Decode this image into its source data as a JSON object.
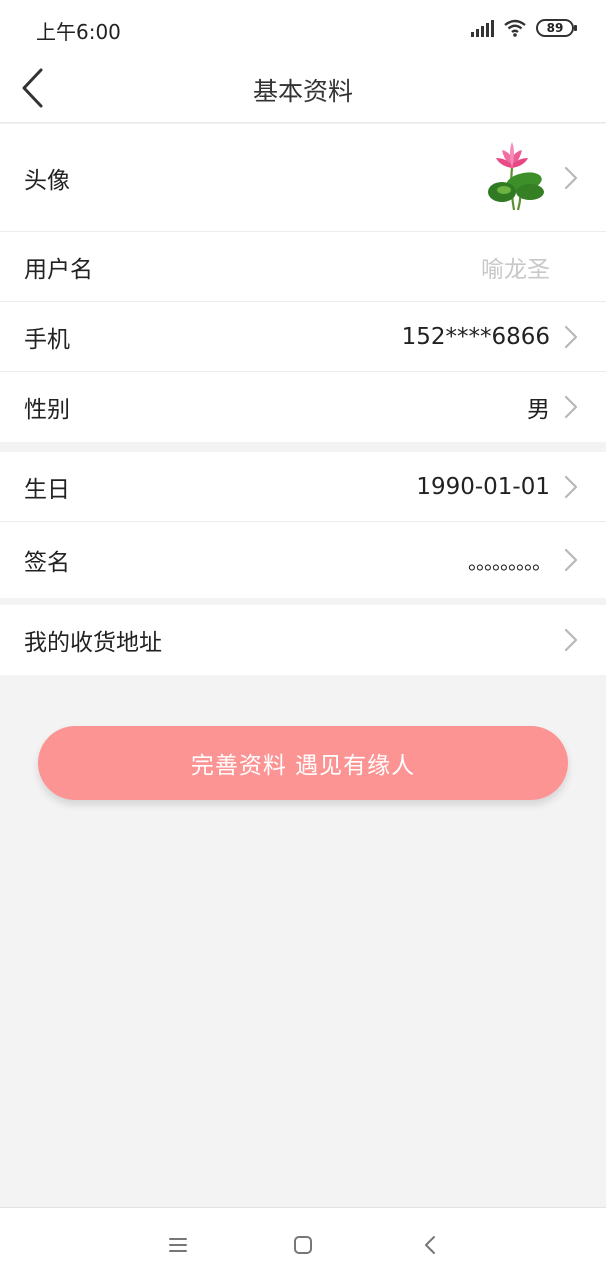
{
  "status_bar": {
    "time": "上午6:00",
    "battery": "89",
    "icons": [
      "signal-icon",
      "wifi-icon",
      "battery-icon"
    ]
  },
  "header": {
    "title": "基本资料",
    "back_icon": "back-chevron-icon"
  },
  "profile": {
    "avatar": {
      "label": "头像",
      "image": "lotus-avatar"
    },
    "username": {
      "label": "用户名",
      "value": "喻龙圣"
    },
    "phone": {
      "label": "手机",
      "value": "152****6866"
    },
    "gender": {
      "label": "性别",
      "value": "男"
    },
    "birthday": {
      "label": "生日",
      "value": "1990-01-01"
    },
    "signature": {
      "label": "签名",
      "value": "。。。。。。。。。"
    },
    "address": {
      "label": "我的收货地址"
    }
  },
  "action": {
    "complete_label": "完善资料 遇见有缘人"
  },
  "system_nav": {
    "icons": [
      "menu-icon",
      "home-icon",
      "back-icon"
    ]
  },
  "colors": {
    "accent_button": "#fd9494",
    "page_background": "#f3f3f3",
    "muted_text": "#c8c8c8"
  }
}
